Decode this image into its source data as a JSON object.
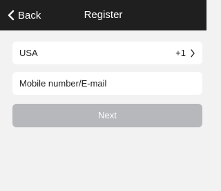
{
  "header": {
    "back_label": "Back",
    "title": "Register"
  },
  "form": {
    "country": "USA",
    "country_code": "+1",
    "account_placeholder": "Mobile number/E-mail",
    "next_label": "Next"
  },
  "icons": {
    "back": "chevron-left-icon",
    "country_arrow": "chevron-right-icon"
  },
  "colors": {
    "header_bg": "#1f1f1f",
    "page_bg": "#f2f2f2",
    "next_button_bg": "#b7b8bb"
  }
}
